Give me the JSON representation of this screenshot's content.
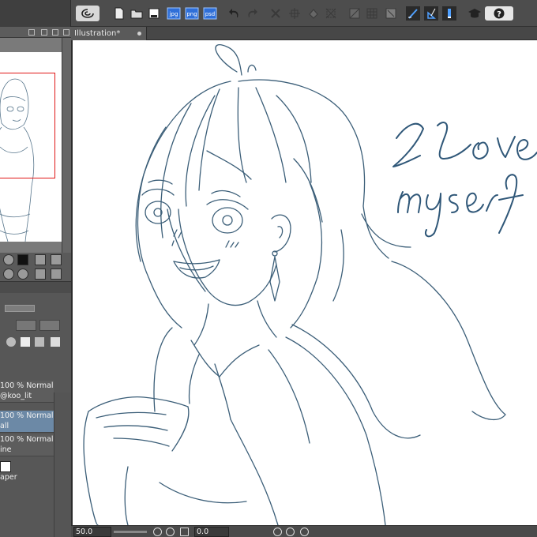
{
  "toolbar": {
    "icons": [
      "app-logo",
      "new-file",
      "open-file",
      "save",
      "export-jpg",
      "export-png",
      "export-psd",
      "undo",
      "redo",
      "clear",
      "transform",
      "fill",
      "deselect",
      "hide-selection",
      "grid",
      "ruler",
      "pen-pressure",
      "pen-tilt",
      "brush-size",
      "tutorial",
      "help"
    ],
    "jpg_label": "jpg",
    "png_label": "png",
    "psd_label": "psd"
  },
  "document": {
    "tab_title": "Illustration*",
    "handwriting_line1": "I Love",
    "handwriting_line2": "myself"
  },
  "layers": [
    {
      "line1": "100 % Normal",
      "line2": "@koo_lit",
      "selected": false
    },
    {
      "line1": "100 % Normal",
      "line2": "all",
      "selected": true
    },
    {
      "line1": "100 % Normal",
      "line2": "ine",
      "selected": false
    },
    {
      "line1": "",
      "line2": "aper",
      "selected": false
    }
  ],
  "status": {
    "zoom": "50.0",
    "angle": "0.0"
  },
  "colors": {
    "line_art": "#3b5e78",
    "navigator_frame": "#e01818",
    "selected_layer": "#6c89a6"
  }
}
